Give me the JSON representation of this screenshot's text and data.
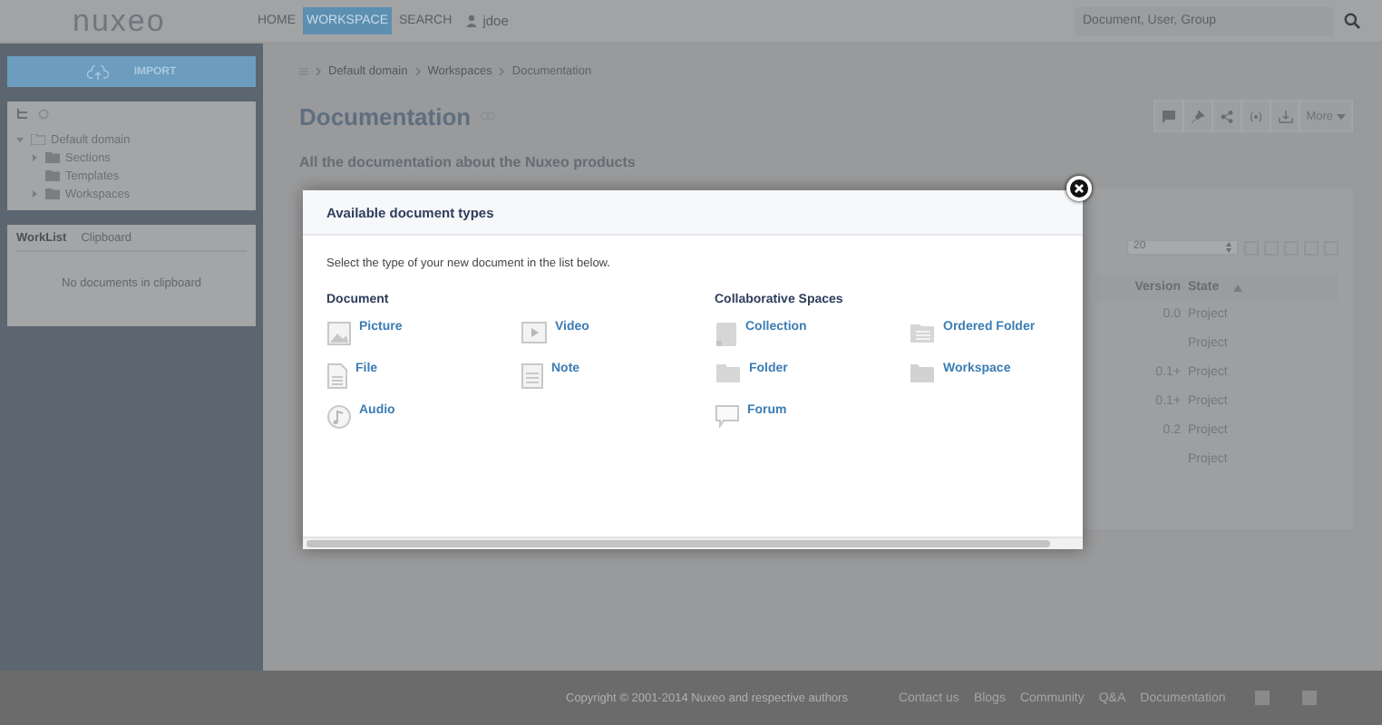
{
  "header": {
    "logo": "nuxeo",
    "nav": [
      {
        "label": "HOME",
        "selected": false
      },
      {
        "label": "WORKSPACE",
        "selected": true
      },
      {
        "label": "SEARCH",
        "selected": false
      }
    ],
    "user": "jdoe",
    "search": {
      "placeholder": "Document, User, Group"
    }
  },
  "sidebar": {
    "import_button": "IMPORT",
    "tree": [
      {
        "label": "Default domain",
        "expanded": true,
        "children": [
          {
            "label": "Sections",
            "expanded": false
          },
          {
            "label": "Templates"
          },
          {
            "label": "Workspaces",
            "expanded": false
          }
        ]
      }
    ],
    "tabs": [
      {
        "label": "WorkList",
        "selected": true
      },
      {
        "label": "Clipboard",
        "selected": false
      }
    ],
    "empty_message": "No documents in clipboard"
  },
  "breadcrumb": [
    "Default domain",
    "Workspaces",
    "Documentation"
  ],
  "title": "Documentation",
  "description": "All the documentation about the Nuxeo products",
  "more_button": "More",
  "table": {
    "page_size": "20",
    "columns": [
      "Version",
      "State"
    ],
    "rows": [
      {
        "version": "0.0",
        "state": "Project"
      },
      {
        "version": "",
        "state": "Project"
      },
      {
        "version": "0.1+",
        "state": "Project"
      },
      {
        "version": "0.1+",
        "state": "Project"
      },
      {
        "version": "0.2",
        "state": "Project"
      },
      {
        "version": "",
        "state": "Project"
      }
    ]
  },
  "dialog": {
    "title": "Available document types",
    "intro": "Select the type of your new document in the list below.",
    "groups": [
      {
        "heading": "Document",
        "items": [
          {
            "label": "Picture",
            "kind": "picture"
          },
          {
            "label": "Video",
            "kind": "video"
          },
          {
            "label": "File",
            "kind": "file"
          },
          {
            "label": "Note",
            "kind": "note"
          },
          {
            "label": "Audio",
            "kind": "audio"
          }
        ]
      },
      {
        "heading": "Collaborative Spaces",
        "items": [
          {
            "label": "Collection",
            "kind": "collection"
          },
          {
            "label": "Ordered Folder",
            "kind": "ordered-folder"
          },
          {
            "label": "Folder",
            "kind": "folder"
          },
          {
            "label": "Workspace",
            "kind": "workspace"
          },
          {
            "label": "Forum",
            "kind": "forum"
          }
        ]
      }
    ]
  },
  "footer": {
    "copyright": "Copyright © 2001-2014 Nuxeo and respective authors",
    "links": [
      "Contact us",
      "Blogs",
      "Community",
      "Q&A",
      "Documentation"
    ]
  }
}
